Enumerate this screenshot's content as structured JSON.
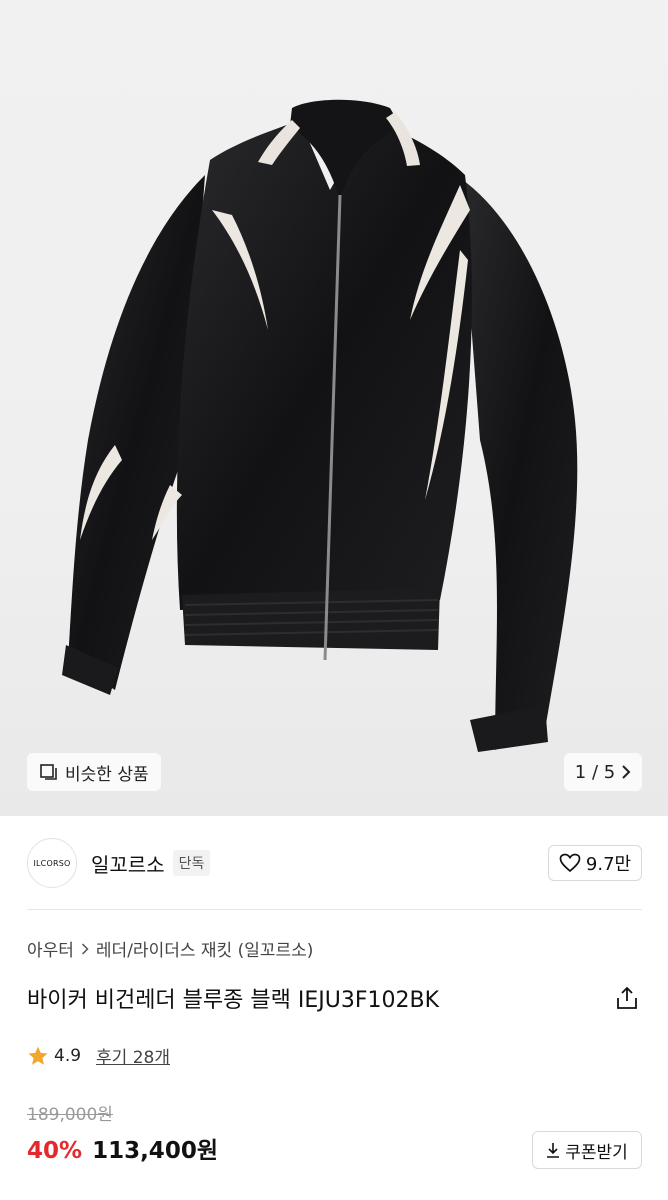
{
  "gallery": {
    "similar_label": "비슷한 상품",
    "counter": "1 / 5",
    "icons": {
      "similar": "similar-icon",
      "next": "chevron-right-icon"
    }
  },
  "brand": {
    "logo_text": "ILCORSO",
    "name": "일꼬르소",
    "badge": "단독",
    "likes": "9.7만"
  },
  "breadcrumb": {
    "category": "아우터",
    "subcategory": "레더/라이더스 재킷 (일꼬르소)"
  },
  "product": {
    "title": "바이커 비건레더 블루종 블랙 IEJU3F102BK",
    "rating": "4.9",
    "reviews": "후기 28개",
    "original_price": "189,000원",
    "discount": "40%",
    "sale_price": "113,400원",
    "coupon_label": "쿠폰받기"
  },
  "colors": {
    "discount": "#e5282b",
    "star": "#f2a62c"
  }
}
